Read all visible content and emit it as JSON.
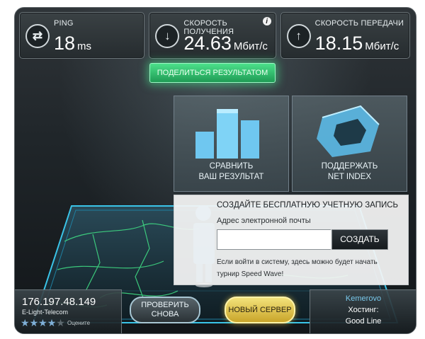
{
  "stats": {
    "ping": {
      "label": "PING",
      "value": "18",
      "unit": "ms"
    },
    "download": {
      "label": "СКОРОСТЬ ПОЛУЧЕНИЯ",
      "value": "24.63",
      "unit": "Мбит/с"
    },
    "upload": {
      "label": "СКОРОСТЬ ПЕРЕДАЧИ",
      "value": "18.15",
      "unit": "Мбит/с"
    }
  },
  "share_label": "ПОДЕЛИТЬСЯ РЕЗУЛЬТАТОМ",
  "tiles": {
    "compare": {
      "line1": "СРАВНИТЬ",
      "line2": "ВАШ РЕЗУЛЬТАТ"
    },
    "netindex": {
      "line1": "ПОДДЕРЖАТЬ",
      "line2": "NET INDEX"
    }
  },
  "account": {
    "heading": "СОЗДАЙТЕ БЕСПЛАТНУЮ УЧЕТНУЮ ЗАПИСЬ",
    "email_label": "Адрес электронной почты",
    "email_value": "",
    "create_label": "СОЗДАТЬ",
    "note": "Если войти в систему, здесь можно будет начать турнир Speed Wave!"
  },
  "client": {
    "ip": "176.197.48.149",
    "isp": "E-Light-Telecom",
    "stars": "★★★★★",
    "rating_count": 4,
    "rate_label": "Оцените"
  },
  "buttons": {
    "test_again": "ПРОВЕРИТЬ СНОВА",
    "new_server": "НОВЫЙ СЕРВЕР"
  },
  "server": {
    "city": "Kemerovo",
    "hosting_label": "Хостинг:",
    "host": "Good Line"
  },
  "colors": {
    "accent_green": "#3fd983",
    "accent_blue": "#4fc3f7",
    "gold": "#e9cf5a"
  },
  "icons": {
    "ping": "ping-arrows-icon",
    "download": "download-arrow-icon",
    "upload": "upload-arrow-icon",
    "info": "info-icon"
  }
}
